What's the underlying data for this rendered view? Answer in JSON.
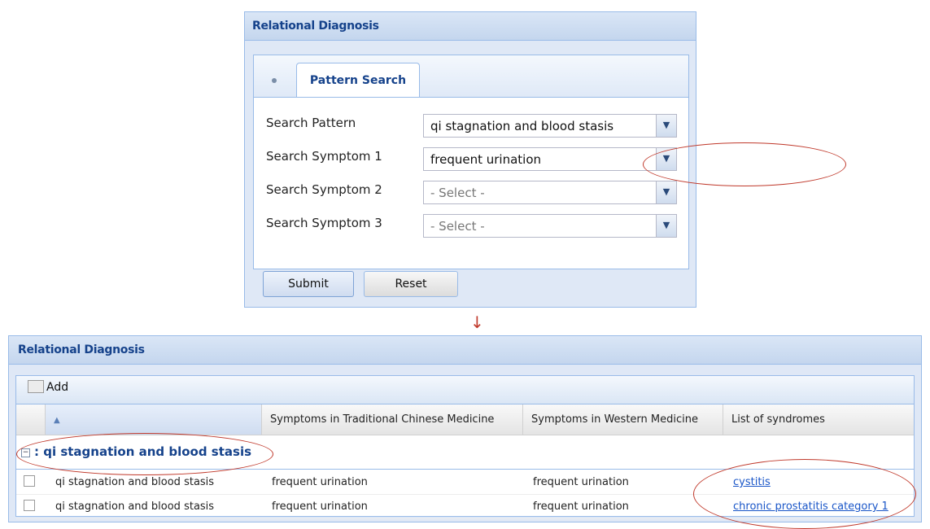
{
  "top_panel": {
    "title": "Relational Diagnosis",
    "tab_label": "Pattern Search",
    "fields": [
      {
        "label": "Search Pattern",
        "value": "qi stagnation and blood stasis",
        "placeholder": false
      },
      {
        "label": "Search Symptom 1",
        "value": "frequent urination",
        "placeholder": false
      },
      {
        "label": "Search Symptom 2",
        "value": "- Select -",
        "placeholder": true
      },
      {
        "label": "Search Symptom 3",
        "value": "- Select -",
        "placeholder": true
      }
    ],
    "submit_label": "Submit",
    "reset_label": "Reset"
  },
  "flow_arrow": "↓",
  "bottom_panel": {
    "title": "Relational Diagnosis",
    "toolbar": {
      "add_label": "Add"
    },
    "columns": [
      "",
      "",
      "Symptoms in Traditional Chinese Medicine",
      "Symptoms in Western Medicine",
      "List of syndromes"
    ],
    "group": {
      "toggle": "−",
      "label": ": qi stagnation and blood stasis"
    },
    "rows": [
      [
        "qi stagnation and blood stasis",
        "frequent urination",
        "frequent urination",
        "cystitis"
      ],
      [
        "qi stagnation and blood stasis",
        "frequent urination",
        "frequent urination",
        "chronic prostatitis category 1"
      ]
    ]
  },
  "colors": {
    "header_blue": "#15428b",
    "border_blue": "#99bbe8",
    "annotation_red": "#c0392b",
    "link_blue": "#1a56c8"
  },
  "icons": {
    "combo_trigger": "chevron-down-icon",
    "sort": "sort-up-icon",
    "add": "folder-icon"
  }
}
